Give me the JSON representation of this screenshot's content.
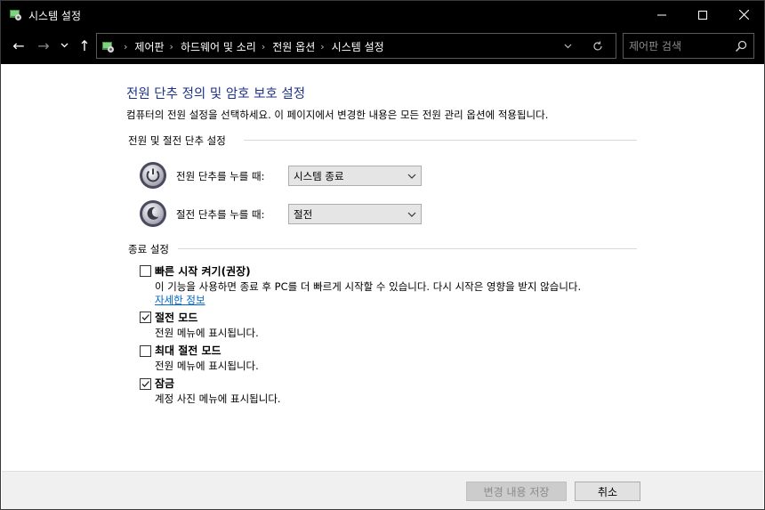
{
  "window": {
    "title": "시스템 설정"
  },
  "titlebar_buttons": {
    "minimize": "—",
    "maximize": "☐",
    "close": "✕"
  },
  "nav": {
    "back": "←",
    "forward": "→",
    "recent": "⌄",
    "up": "↑"
  },
  "breadcrumbs": [
    "제어판",
    "하드웨어 및 소리",
    "전원 옵션",
    "시스템 설정"
  ],
  "search": {
    "placeholder": "제어판 검색",
    "value": ""
  },
  "main": {
    "title": "전원 단추 정의 및 암호 보호 설정",
    "description": "컴퓨터의 전원 설정을 선택하세요. 이 페이지에서 변경한 내용은 모든 전원 관리 옵션에 적용됩니다.",
    "power_section": {
      "title": "전원 및 절전 단추 설정",
      "rows": [
        {
          "label": "전원 단추를 누를 때:",
          "value": "시스템 종료"
        },
        {
          "label": "절전 단추를 누를 때:",
          "value": "절전"
        }
      ]
    },
    "shutdown_section": {
      "title": "종료 설정",
      "items": [
        {
          "label": "빠른 시작 켜기(권장)",
          "checked": false,
          "description": "이 기능을 사용하면 종료 후 PC를 더 빠르게 시작할 수 있습니다. 다시 시작은 영향을 받지 않습니다.",
          "link": "자세한 정보"
        },
        {
          "label": "절전 모드",
          "checked": true,
          "description": "전원 메뉴에 표시됩니다."
        },
        {
          "label": "최대 절전 모드",
          "checked": false,
          "description": "전원 메뉴에 표시됩니다."
        },
        {
          "label": "잠금",
          "checked": true,
          "description": "계정 사진 메뉴에 표시됩니다."
        }
      ]
    }
  },
  "footer": {
    "save_label": "변경 내용 저장",
    "cancel_label": "취소"
  },
  "colors": {
    "title_blue": "#1e3287",
    "link_blue": "#0066cc",
    "chrome_black": "#000000"
  },
  "icons": [
    "control-panel-icon",
    "power-button-icon",
    "sleep-button-icon",
    "checkbox-check-icon",
    "search-icon",
    "refresh-icon",
    "chevron-down-icon"
  ]
}
